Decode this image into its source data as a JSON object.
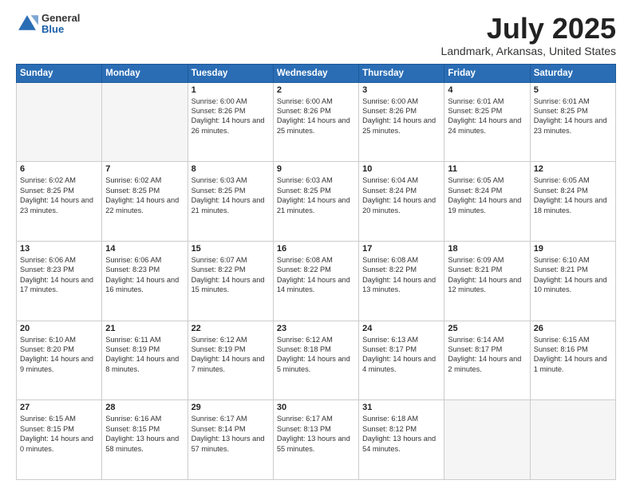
{
  "logo": {
    "general": "General",
    "blue": "Blue"
  },
  "header": {
    "title": "July 2025",
    "subtitle": "Landmark, Arkansas, United States"
  },
  "weekdays": [
    "Sunday",
    "Monday",
    "Tuesday",
    "Wednesday",
    "Thursday",
    "Friday",
    "Saturday"
  ],
  "weeks": [
    [
      {
        "day": null
      },
      {
        "day": null
      },
      {
        "day": "1",
        "sunrise": "Sunrise: 6:00 AM",
        "sunset": "Sunset: 8:26 PM",
        "daylight": "Daylight: 14 hours and 26 minutes."
      },
      {
        "day": "2",
        "sunrise": "Sunrise: 6:00 AM",
        "sunset": "Sunset: 8:26 PM",
        "daylight": "Daylight: 14 hours and 25 minutes."
      },
      {
        "day": "3",
        "sunrise": "Sunrise: 6:00 AM",
        "sunset": "Sunset: 8:26 PM",
        "daylight": "Daylight: 14 hours and 25 minutes."
      },
      {
        "day": "4",
        "sunrise": "Sunrise: 6:01 AM",
        "sunset": "Sunset: 8:25 PM",
        "daylight": "Daylight: 14 hours and 24 minutes."
      },
      {
        "day": "5",
        "sunrise": "Sunrise: 6:01 AM",
        "sunset": "Sunset: 8:25 PM",
        "daylight": "Daylight: 14 hours and 23 minutes."
      }
    ],
    [
      {
        "day": "6",
        "sunrise": "Sunrise: 6:02 AM",
        "sunset": "Sunset: 8:25 PM",
        "daylight": "Daylight: 14 hours and 23 minutes."
      },
      {
        "day": "7",
        "sunrise": "Sunrise: 6:02 AM",
        "sunset": "Sunset: 8:25 PM",
        "daylight": "Daylight: 14 hours and 22 minutes."
      },
      {
        "day": "8",
        "sunrise": "Sunrise: 6:03 AM",
        "sunset": "Sunset: 8:25 PM",
        "daylight": "Daylight: 14 hours and 21 minutes."
      },
      {
        "day": "9",
        "sunrise": "Sunrise: 6:03 AM",
        "sunset": "Sunset: 8:25 PM",
        "daylight": "Daylight: 14 hours and 21 minutes."
      },
      {
        "day": "10",
        "sunrise": "Sunrise: 6:04 AM",
        "sunset": "Sunset: 8:24 PM",
        "daylight": "Daylight: 14 hours and 20 minutes."
      },
      {
        "day": "11",
        "sunrise": "Sunrise: 6:05 AM",
        "sunset": "Sunset: 8:24 PM",
        "daylight": "Daylight: 14 hours and 19 minutes."
      },
      {
        "day": "12",
        "sunrise": "Sunrise: 6:05 AM",
        "sunset": "Sunset: 8:24 PM",
        "daylight": "Daylight: 14 hours and 18 minutes."
      }
    ],
    [
      {
        "day": "13",
        "sunrise": "Sunrise: 6:06 AM",
        "sunset": "Sunset: 8:23 PM",
        "daylight": "Daylight: 14 hours and 17 minutes."
      },
      {
        "day": "14",
        "sunrise": "Sunrise: 6:06 AM",
        "sunset": "Sunset: 8:23 PM",
        "daylight": "Daylight: 14 hours and 16 minutes."
      },
      {
        "day": "15",
        "sunrise": "Sunrise: 6:07 AM",
        "sunset": "Sunset: 8:22 PM",
        "daylight": "Daylight: 14 hours and 15 minutes."
      },
      {
        "day": "16",
        "sunrise": "Sunrise: 6:08 AM",
        "sunset": "Sunset: 8:22 PM",
        "daylight": "Daylight: 14 hours and 14 minutes."
      },
      {
        "day": "17",
        "sunrise": "Sunrise: 6:08 AM",
        "sunset": "Sunset: 8:22 PM",
        "daylight": "Daylight: 14 hours and 13 minutes."
      },
      {
        "day": "18",
        "sunrise": "Sunrise: 6:09 AM",
        "sunset": "Sunset: 8:21 PM",
        "daylight": "Daylight: 14 hours and 12 minutes."
      },
      {
        "day": "19",
        "sunrise": "Sunrise: 6:10 AM",
        "sunset": "Sunset: 8:21 PM",
        "daylight": "Daylight: 14 hours and 10 minutes."
      }
    ],
    [
      {
        "day": "20",
        "sunrise": "Sunrise: 6:10 AM",
        "sunset": "Sunset: 8:20 PM",
        "daylight": "Daylight: 14 hours and 9 minutes."
      },
      {
        "day": "21",
        "sunrise": "Sunrise: 6:11 AM",
        "sunset": "Sunset: 8:19 PM",
        "daylight": "Daylight: 14 hours and 8 minutes."
      },
      {
        "day": "22",
        "sunrise": "Sunrise: 6:12 AM",
        "sunset": "Sunset: 8:19 PM",
        "daylight": "Daylight: 14 hours and 7 minutes."
      },
      {
        "day": "23",
        "sunrise": "Sunrise: 6:12 AM",
        "sunset": "Sunset: 8:18 PM",
        "daylight": "Daylight: 14 hours and 5 minutes."
      },
      {
        "day": "24",
        "sunrise": "Sunrise: 6:13 AM",
        "sunset": "Sunset: 8:17 PM",
        "daylight": "Daylight: 14 hours and 4 minutes."
      },
      {
        "day": "25",
        "sunrise": "Sunrise: 6:14 AM",
        "sunset": "Sunset: 8:17 PM",
        "daylight": "Daylight: 14 hours and 2 minutes."
      },
      {
        "day": "26",
        "sunrise": "Sunrise: 6:15 AM",
        "sunset": "Sunset: 8:16 PM",
        "daylight": "Daylight: 14 hours and 1 minute."
      }
    ],
    [
      {
        "day": "27",
        "sunrise": "Sunrise: 6:15 AM",
        "sunset": "Sunset: 8:15 PM",
        "daylight": "Daylight: 14 hours and 0 minutes."
      },
      {
        "day": "28",
        "sunrise": "Sunrise: 6:16 AM",
        "sunset": "Sunset: 8:15 PM",
        "daylight": "Daylight: 13 hours and 58 minutes."
      },
      {
        "day": "29",
        "sunrise": "Sunrise: 6:17 AM",
        "sunset": "Sunset: 8:14 PM",
        "daylight": "Daylight: 13 hours and 57 minutes."
      },
      {
        "day": "30",
        "sunrise": "Sunrise: 6:17 AM",
        "sunset": "Sunset: 8:13 PM",
        "daylight": "Daylight: 13 hours and 55 minutes."
      },
      {
        "day": "31",
        "sunrise": "Sunrise: 6:18 AM",
        "sunset": "Sunset: 8:12 PM",
        "daylight": "Daylight: 13 hours and 54 minutes."
      },
      {
        "day": null
      },
      {
        "day": null
      }
    ]
  ]
}
